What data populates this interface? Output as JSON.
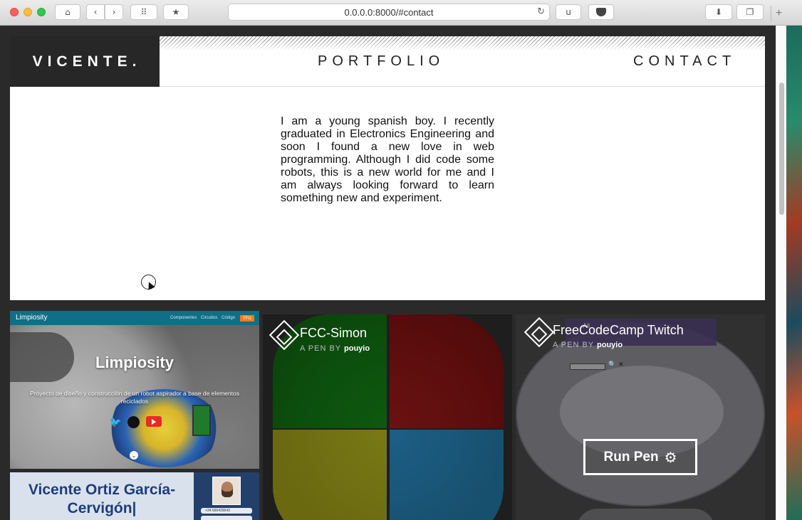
{
  "browser": {
    "url": "0.0.0.0:8000/#contact",
    "extension_label": "u",
    "buttons": [
      "home-icon",
      "back-icon",
      "forward-icon",
      "grid-icon",
      "bookmark-icon",
      "reload-icon",
      "pocket-icon",
      "download-icon",
      "tabs-icon",
      "new-tab-icon"
    ]
  },
  "site": {
    "logo": "VICENTE.",
    "nav": {
      "portfolio": "PORTFOLIO",
      "contact": "CONTACT"
    },
    "about": "I am a young spanish boy. I recently graduated in Electronics Engineering and soon I found a new love in web programming. Although I did code some robots, this is a new world for me and I am always looking forward to learn something new and experiment."
  },
  "projects": {
    "limpiosity": {
      "brand": "Limpiosity",
      "nav": [
        "Componentes",
        "Circuitos",
        "Código"
      ],
      "badge": "TFG",
      "title": "Limpiosity",
      "subtitle": "Proyecto de diseño y construcción de un robot aspirador a base de elementos reciclados"
    },
    "cv": {
      "name": "Vicente Ortiz García-Cervigón|",
      "phone": "+34 666429643"
    },
    "simon": {
      "title": "FCC-Simon",
      "by_label": "A PEN BY",
      "author": "pouyio"
    },
    "twitch": {
      "title": "FreeCodeCamp Twitch",
      "by_label": "A PEN BY",
      "author": "pouyio",
      "all_label": "All",
      "run_label": "Run Pen"
    }
  }
}
